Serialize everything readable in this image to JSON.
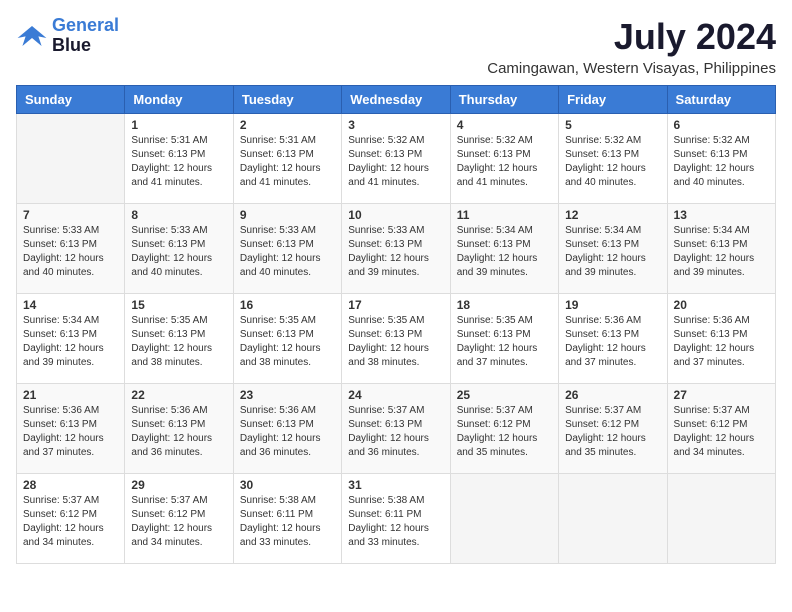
{
  "logo": {
    "line1": "General",
    "line2": "Blue"
  },
  "title": "July 2024",
  "location": "Camingawan, Western Visayas, Philippines",
  "days_of_week": [
    "Sunday",
    "Monday",
    "Tuesday",
    "Wednesday",
    "Thursday",
    "Friday",
    "Saturday"
  ],
  "weeks": [
    [
      {
        "day": "",
        "sunrise": "",
        "sunset": "",
        "daylight": ""
      },
      {
        "day": "1",
        "sunrise": "Sunrise: 5:31 AM",
        "sunset": "Sunset: 6:13 PM",
        "daylight": "Daylight: 12 hours and 41 minutes."
      },
      {
        "day": "2",
        "sunrise": "Sunrise: 5:31 AM",
        "sunset": "Sunset: 6:13 PM",
        "daylight": "Daylight: 12 hours and 41 minutes."
      },
      {
        "day": "3",
        "sunrise": "Sunrise: 5:32 AM",
        "sunset": "Sunset: 6:13 PM",
        "daylight": "Daylight: 12 hours and 41 minutes."
      },
      {
        "day": "4",
        "sunrise": "Sunrise: 5:32 AM",
        "sunset": "Sunset: 6:13 PM",
        "daylight": "Daylight: 12 hours and 41 minutes."
      },
      {
        "day": "5",
        "sunrise": "Sunrise: 5:32 AM",
        "sunset": "Sunset: 6:13 PM",
        "daylight": "Daylight: 12 hours and 40 minutes."
      },
      {
        "day": "6",
        "sunrise": "Sunrise: 5:32 AM",
        "sunset": "Sunset: 6:13 PM",
        "daylight": "Daylight: 12 hours and 40 minutes."
      }
    ],
    [
      {
        "day": "7",
        "sunrise": "Sunrise: 5:33 AM",
        "sunset": "Sunset: 6:13 PM",
        "daylight": "Daylight: 12 hours and 40 minutes."
      },
      {
        "day": "8",
        "sunrise": "Sunrise: 5:33 AM",
        "sunset": "Sunset: 6:13 PM",
        "daylight": "Daylight: 12 hours and 40 minutes."
      },
      {
        "day": "9",
        "sunrise": "Sunrise: 5:33 AM",
        "sunset": "Sunset: 6:13 PM",
        "daylight": "Daylight: 12 hours and 40 minutes."
      },
      {
        "day": "10",
        "sunrise": "Sunrise: 5:33 AM",
        "sunset": "Sunset: 6:13 PM",
        "daylight": "Daylight: 12 hours and 39 minutes."
      },
      {
        "day": "11",
        "sunrise": "Sunrise: 5:34 AM",
        "sunset": "Sunset: 6:13 PM",
        "daylight": "Daylight: 12 hours and 39 minutes."
      },
      {
        "day": "12",
        "sunrise": "Sunrise: 5:34 AM",
        "sunset": "Sunset: 6:13 PM",
        "daylight": "Daylight: 12 hours and 39 minutes."
      },
      {
        "day": "13",
        "sunrise": "Sunrise: 5:34 AM",
        "sunset": "Sunset: 6:13 PM",
        "daylight": "Daylight: 12 hours and 39 minutes."
      }
    ],
    [
      {
        "day": "14",
        "sunrise": "Sunrise: 5:34 AM",
        "sunset": "Sunset: 6:13 PM",
        "daylight": "Daylight: 12 hours and 39 minutes."
      },
      {
        "day": "15",
        "sunrise": "Sunrise: 5:35 AM",
        "sunset": "Sunset: 6:13 PM",
        "daylight": "Daylight: 12 hours and 38 minutes."
      },
      {
        "day": "16",
        "sunrise": "Sunrise: 5:35 AM",
        "sunset": "Sunset: 6:13 PM",
        "daylight": "Daylight: 12 hours and 38 minutes."
      },
      {
        "day": "17",
        "sunrise": "Sunrise: 5:35 AM",
        "sunset": "Sunset: 6:13 PM",
        "daylight": "Daylight: 12 hours and 38 minutes."
      },
      {
        "day": "18",
        "sunrise": "Sunrise: 5:35 AM",
        "sunset": "Sunset: 6:13 PM",
        "daylight": "Daylight: 12 hours and 37 minutes."
      },
      {
        "day": "19",
        "sunrise": "Sunrise: 5:36 AM",
        "sunset": "Sunset: 6:13 PM",
        "daylight": "Daylight: 12 hours and 37 minutes."
      },
      {
        "day": "20",
        "sunrise": "Sunrise: 5:36 AM",
        "sunset": "Sunset: 6:13 PM",
        "daylight": "Daylight: 12 hours and 37 minutes."
      }
    ],
    [
      {
        "day": "21",
        "sunrise": "Sunrise: 5:36 AM",
        "sunset": "Sunset: 6:13 PM",
        "daylight": "Daylight: 12 hours and 37 minutes."
      },
      {
        "day": "22",
        "sunrise": "Sunrise: 5:36 AM",
        "sunset": "Sunset: 6:13 PM",
        "daylight": "Daylight: 12 hours and 36 minutes."
      },
      {
        "day": "23",
        "sunrise": "Sunrise: 5:36 AM",
        "sunset": "Sunset: 6:13 PM",
        "daylight": "Daylight: 12 hours and 36 minutes."
      },
      {
        "day": "24",
        "sunrise": "Sunrise: 5:37 AM",
        "sunset": "Sunset: 6:13 PM",
        "daylight": "Daylight: 12 hours and 36 minutes."
      },
      {
        "day": "25",
        "sunrise": "Sunrise: 5:37 AM",
        "sunset": "Sunset: 6:12 PM",
        "daylight": "Daylight: 12 hours and 35 minutes."
      },
      {
        "day": "26",
        "sunrise": "Sunrise: 5:37 AM",
        "sunset": "Sunset: 6:12 PM",
        "daylight": "Daylight: 12 hours and 35 minutes."
      },
      {
        "day": "27",
        "sunrise": "Sunrise: 5:37 AM",
        "sunset": "Sunset: 6:12 PM",
        "daylight": "Daylight: 12 hours and 34 minutes."
      }
    ],
    [
      {
        "day": "28",
        "sunrise": "Sunrise: 5:37 AM",
        "sunset": "Sunset: 6:12 PM",
        "daylight": "Daylight: 12 hours and 34 minutes."
      },
      {
        "day": "29",
        "sunrise": "Sunrise: 5:37 AM",
        "sunset": "Sunset: 6:12 PM",
        "daylight": "Daylight: 12 hours and 34 minutes."
      },
      {
        "day": "30",
        "sunrise": "Sunrise: 5:38 AM",
        "sunset": "Sunset: 6:11 PM",
        "daylight": "Daylight: 12 hours and 33 minutes."
      },
      {
        "day": "31",
        "sunrise": "Sunrise: 5:38 AM",
        "sunset": "Sunset: 6:11 PM",
        "daylight": "Daylight: 12 hours and 33 minutes."
      },
      {
        "day": "",
        "sunrise": "",
        "sunset": "",
        "daylight": ""
      },
      {
        "day": "",
        "sunrise": "",
        "sunset": "",
        "daylight": ""
      },
      {
        "day": "",
        "sunrise": "",
        "sunset": "",
        "daylight": ""
      }
    ]
  ]
}
